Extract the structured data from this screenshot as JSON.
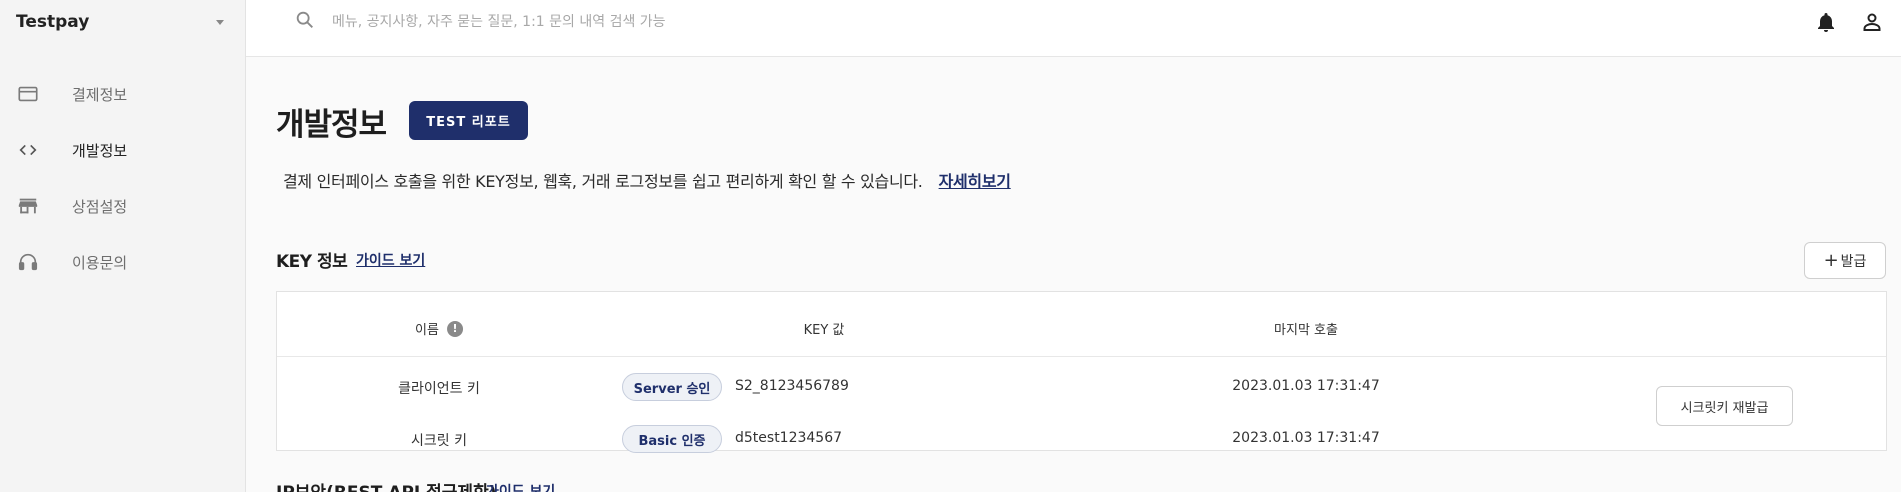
{
  "brand": {
    "name": "Testpay",
    "caret": "chevron-down-icon"
  },
  "sidebar": {
    "items": [
      {
        "label": "결제정보",
        "icon": "credit-card-icon",
        "active": false
      },
      {
        "label": "개발정보",
        "icon": "code-icon",
        "active": true
      },
      {
        "label": "상점설정",
        "icon": "store-icon",
        "active": false
      },
      {
        "label": "이용문의",
        "icon": "headphones-icon",
        "active": false
      }
    ]
  },
  "topbar": {
    "search": {
      "placeholder": "메뉴, 공지사항, 자주 묻는 질문, 1:1 문의 내역 검색 가능",
      "icon": "search-icon"
    },
    "icons": [
      "bell-icon",
      "user-icon"
    ]
  },
  "page": {
    "title": "개발정보",
    "test_report_label": "TEST 리포트",
    "description": "결제 인터페이스 호출을 위한 KEY정보, 웹훅, 거래 로그정보를 쉽고 편리하게 확인 할 수 있습니다.",
    "detail_link": "자세히보기"
  },
  "key_section": {
    "title": "KEY 정보",
    "guide_link": "가이드 보기",
    "issue_button": "발급",
    "columns": {
      "name": "이름",
      "key": "KEY 값",
      "last_call": "마지막 호출"
    },
    "rows": [
      {
        "name": "클라이언트 키",
        "badge": "Server 승인",
        "key": "S2_8123456789",
        "last_call": "2023.01.03 17:31:47"
      },
      {
        "name": "시크릿 키",
        "badge": "Basic 인증",
        "key": "d5test1234567",
        "last_call": "2023.01.03 17:31:47"
      }
    ],
    "reissue_button": "시크릿키 재발급"
  },
  "next_section": {
    "title": "IP보안(REST API 접근제한)",
    "guide_link": "가이드 보기"
  },
  "colors": {
    "accent": "#1f2f6b",
    "sidebar_bg": "#f4f4f4"
  }
}
